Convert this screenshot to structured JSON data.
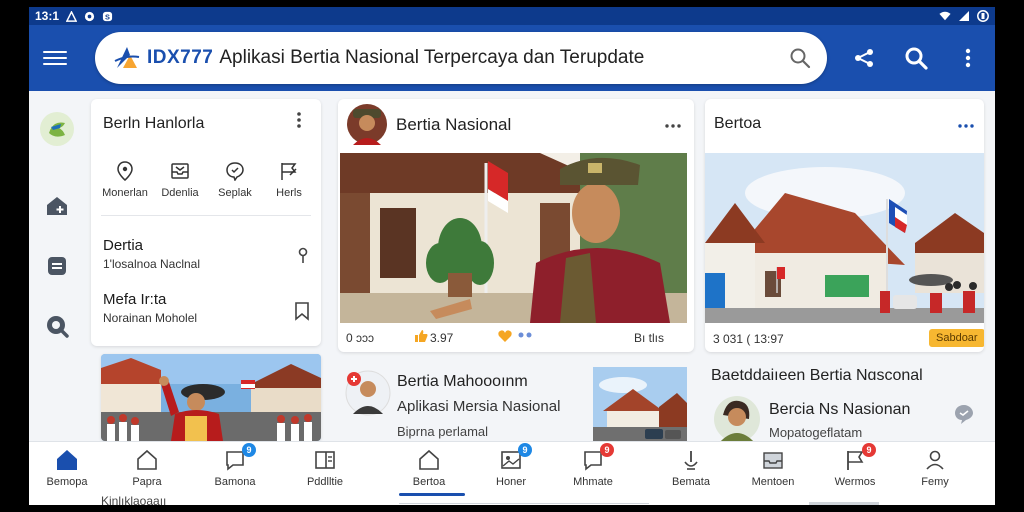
{
  "status": {
    "time": "13:1"
  },
  "appbar": {
    "brand_code": "IDX777",
    "tagline": "Aplikasi Bertia Nasional Terpercaya dan Terupdate"
  },
  "colors": {
    "primary": "#1a4fae",
    "status_bar": "#0d3a8c",
    "badge_blue": "#1e88e5",
    "badge_red": "#e53935",
    "badge_orange": "#f7b731"
  },
  "left_card": {
    "title": "Berln Hanlorla",
    "chips": [
      {
        "label": "Monerlan",
        "icon": "location-pin-icon"
      },
      {
        "label": "Ddenlia",
        "icon": "inbox-icon"
      },
      {
        "label": "Seplak",
        "icon": "chat-bubble-icon"
      },
      {
        "label": "Herls",
        "icon": "flag-edit-icon"
      }
    ],
    "rows": [
      {
        "title": "Dertia",
        "subtitle": "1'losalnoa Naclnal",
        "icon": "pin-icon"
      },
      {
        "title": "Mefa Ir:ta",
        "subtitle": "Norainan Moholel",
        "icon": "bookmark-icon"
      }
    ]
  },
  "main_card": {
    "title": "Bertia Nasional",
    "meta": {
      "views": "0 ɔɔɔ",
      "likes": "3.97",
      "tail": "Bı tlıs"
    }
  },
  "right_card": {
    "title": "Bertoa",
    "meta": "3 031  ( 13:97",
    "badge": "Sabdoar"
  },
  "row2": {
    "center_title": "Bertia Mahoooınm",
    "center_sub1": "Aplikasi Mersia Nasional",
    "center_sub2": "Biprna perlamal",
    "right_heading": "Baetddaiıeen Bertia Nɑsconal",
    "right_item_title": "Bercia  Ns Nasionan",
    "right_item_sub": "Mopatogeflatam"
  },
  "left_nav": [
    {
      "label": "Bemopa",
      "icon": "home-icon"
    },
    {
      "label": "Papra",
      "icon": "house-outline-icon"
    },
    {
      "label": "Bamona",
      "icon": "chat-icon",
      "badge": "9"
    },
    {
      "label": "Pddlltie",
      "icon": "split-panel-icon"
    }
  ],
  "right_nav": [
    {
      "label": "Bertoa",
      "icon": "house-outline-icon"
    },
    {
      "label": "Honer",
      "icon": "image-icon",
      "badge": "9"
    },
    {
      "label": "Mhmate",
      "icon": "chat-icon",
      "badge": "9"
    },
    {
      "label": "Bemata",
      "icon": "mic-icon"
    },
    {
      "label": "Mentoen",
      "icon": "inbox-icon"
    },
    {
      "label": "Wermos",
      "icon": "flag-icon",
      "badge": "9"
    },
    {
      "label": "Femy",
      "icon": "person-icon"
    }
  ],
  "peek": {
    "left_text": "Kinlıklaoaaıı"
  }
}
